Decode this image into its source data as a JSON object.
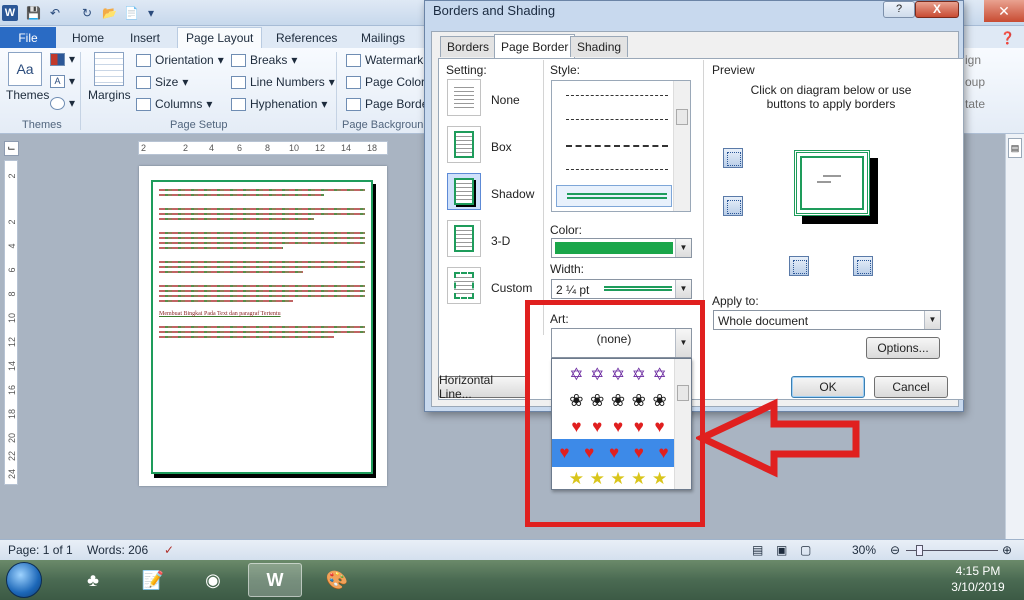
{
  "titlebar": {
    "logo": "W"
  },
  "ribbon_tabs": [
    "File",
    "Home",
    "Insert",
    "Page Layout",
    "References",
    "Mailings"
  ],
  "ribbon": {
    "themes": "Themes",
    "margins": "Margins",
    "orientation": "Orientation",
    "size": "Size",
    "columns": "Columns",
    "breaks": "Breaks",
    "line_numbers": "Line Numbers",
    "hyphenation": "Hyphenation",
    "watermark": "Watermark",
    "page_color": "Page Color",
    "page_borders": "Page Borde",
    "group_themes": "Themes",
    "group_page_setup": "Page Setup",
    "group_page_background": "Page Backgroun",
    "right_cut_1": "ign",
    "right_cut_2": "oup",
    "right_cut_3": "tate"
  },
  "ruler": {
    "top": [
      "2",
      "2",
      "4",
      "6",
      "8",
      "10",
      "12",
      "14",
      "16",
      "18"
    ],
    "left": [
      "2",
      "2",
      "4",
      "6",
      "8",
      "10",
      "12",
      "14",
      "16",
      "18",
      "20",
      "22",
      "24"
    ]
  },
  "document": {
    "heading": "Membuat Bingkai Pada Text dan paragraf Tertentu"
  },
  "dialog": {
    "title": "Borders and Shading",
    "help": "?",
    "close": "X",
    "tabs": [
      "Borders",
      "Page Border",
      "Shading"
    ],
    "setting_label": "Setting:",
    "settings": [
      "None",
      "Box",
      "Shadow",
      "3-D",
      "Custom"
    ],
    "style_label": "Style:",
    "color_label": "Color:",
    "color_value": "#1aa64a",
    "width_label": "Width:",
    "width_value": "2 ¼ pt",
    "art_label": "Art:",
    "art_value": "(none)",
    "preview_label": "Preview",
    "preview_hint": "Click on diagram below or use buttons to apply borders",
    "apply_label": "Apply to:",
    "apply_value": "Whole document",
    "options": "Options...",
    "horizontal_line": "Horizontal Line...",
    "ok": "OK",
    "cancel": "Cancel"
  },
  "status": {
    "page": "Page: 1 of 1",
    "words": "Words: 206",
    "zoom": "30%"
  },
  "clock": {
    "time": "4:15 PM",
    "date": "3/10/2019"
  },
  "accent": {
    "highlight": "#e0201f",
    "border_green": "#1e9c5b"
  }
}
